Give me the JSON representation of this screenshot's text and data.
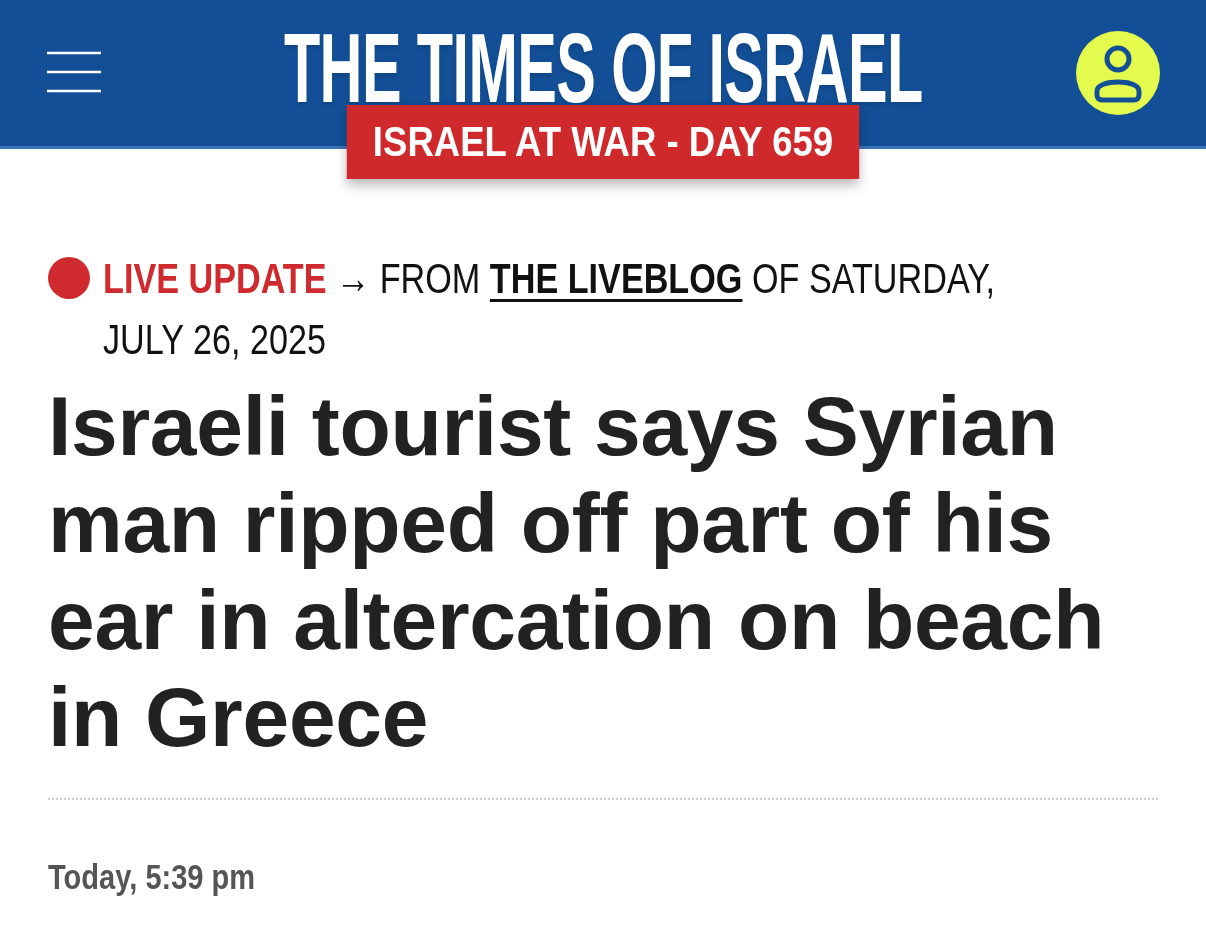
{
  "header": {
    "logo": "THE TIMES OF ISRAEL",
    "banner": "ISRAEL AT WAR - DAY 659"
  },
  "live_update": {
    "label": "LIVE UPDATE",
    "arrow": "→",
    "lead": "FROM",
    "link": "THE LIVEBLOG",
    "tail": "OF SATURDAY, JULY 26, 2025"
  },
  "article": {
    "headline": "Israeli tourist says Syrian man ripped off part of his ear in altercation on beach in Greece",
    "timestamp": "Today, 5:39 pm"
  }
}
